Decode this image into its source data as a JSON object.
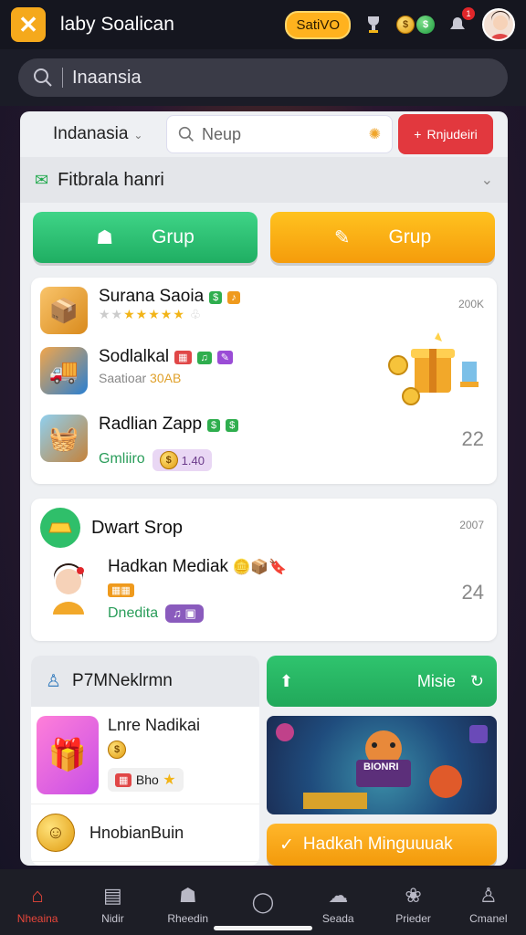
{
  "app": {
    "title": "laby Soalican",
    "pill_label": "SatiVO",
    "brand_color": "#f5a91c"
  },
  "search": {
    "value": "Inaansia"
  },
  "panel": {
    "region": "Indanasia",
    "inner_search_placeholder": "Neup",
    "action_button": "Rnjudeiri",
    "filter_label": "Fitbrala hanri",
    "group_buttons": [
      "Grup",
      "Grup"
    ]
  },
  "list1": [
    {
      "title": "Surana Saoia",
      "meta": "200K",
      "sub": ""
    },
    {
      "title": "Sodlalkal",
      "meta": "",
      "sub": "Saatioar",
      "extra": "30AB"
    },
    {
      "title": "Radlian Zapp",
      "meta": "22",
      "sub": "Gmliiro",
      "price": "1.40"
    }
  ],
  "list2": {
    "header": "Dwart Srop",
    "header_meta": "2007",
    "item": {
      "title": "Hadkan Mediak",
      "sub": "Dnedita",
      "meta": "24"
    }
  },
  "bottom_left": {
    "header": "P7MNeklrmn",
    "item1": {
      "title": "Lnre Nadikai",
      "sub": "Bho"
    },
    "item2": {
      "title": "HnobianBuin"
    }
  },
  "bottom_right": {
    "header": "Misie",
    "art_sign": "BIONRI",
    "cta": "Hadkah Minguuuak"
  },
  "nav": [
    {
      "label": "Nheaina",
      "icon": "home-icon",
      "active": true
    },
    {
      "label": "Nidir",
      "icon": "store-icon",
      "active": false
    },
    {
      "label": "Rheedin",
      "icon": "shirt-icon",
      "active": false
    },
    {
      "label": "",
      "icon": "circle-icon",
      "active": false
    },
    {
      "label": "Seada",
      "icon": "chat-icon",
      "active": false
    },
    {
      "label": "Prieder",
      "icon": "gift-icon",
      "active": false
    },
    {
      "label": "Cmanel",
      "icon": "profile-icon",
      "active": false
    }
  ]
}
